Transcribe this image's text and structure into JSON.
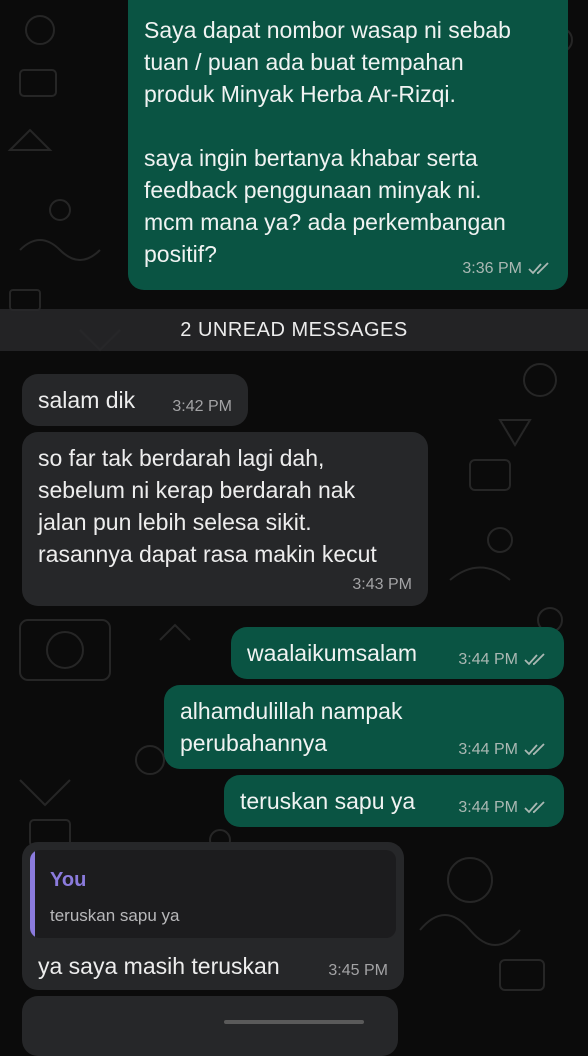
{
  "messages": [
    {
      "id": "out-1",
      "direction": "outgoing",
      "lines": [
        "Saya dapat nombor wasap ni sebab",
        "tuan / puan ada buat tempahan",
        "produk Minyak Herba Ar-Rizqi.",
        "",
        "saya ingin bertanya khabar serta",
        "feedback penggunaan minyak ni.",
        "mcm mana ya? ada perkembangan",
        "positif?"
      ],
      "time": "3:36 PM",
      "status": "read"
    },
    {
      "id": "in-1",
      "direction": "incoming",
      "lines": [
        "salam dik"
      ],
      "time": "3:42 PM"
    },
    {
      "id": "in-2",
      "direction": "incoming",
      "lines": [
        "so far tak berdarah lagi dah,",
        "sebelum ni kerap berdarah nak",
        "jalan pun lebih selesa sikit.",
        "rasannya dapat rasa makin kecut"
      ],
      "time": "3:43 PM"
    },
    {
      "id": "out-2",
      "direction": "outgoing",
      "lines": [
        "waalaikumsalam"
      ],
      "time": "3:44 PM",
      "status": "read"
    },
    {
      "id": "out-3",
      "direction": "outgoing",
      "lines": [
        "alhamdulillah nampak",
        "perubahannya"
      ],
      "time": "3:44 PM",
      "status": "read"
    },
    {
      "id": "out-4",
      "direction": "outgoing",
      "lines": [
        "teruskan sapu ya"
      ],
      "time": "3:44 PM",
      "status": "read"
    },
    {
      "id": "in-3",
      "direction": "incoming",
      "quote": {
        "author": "You",
        "text": "teruskan sapu ya"
      },
      "lines": [
        "ya saya masih teruskan"
      ],
      "time": "3:45 PM"
    }
  ],
  "unread_divider": "2 UNREAD MESSAGES",
  "colors": {
    "outgoing_bubble": "#0a5443",
    "incoming_bubble": "#262729",
    "quote_accent": "#8b7bdd",
    "background": "#0b0b0b"
  },
  "icons": [
    "double-check-read-icon"
  ]
}
